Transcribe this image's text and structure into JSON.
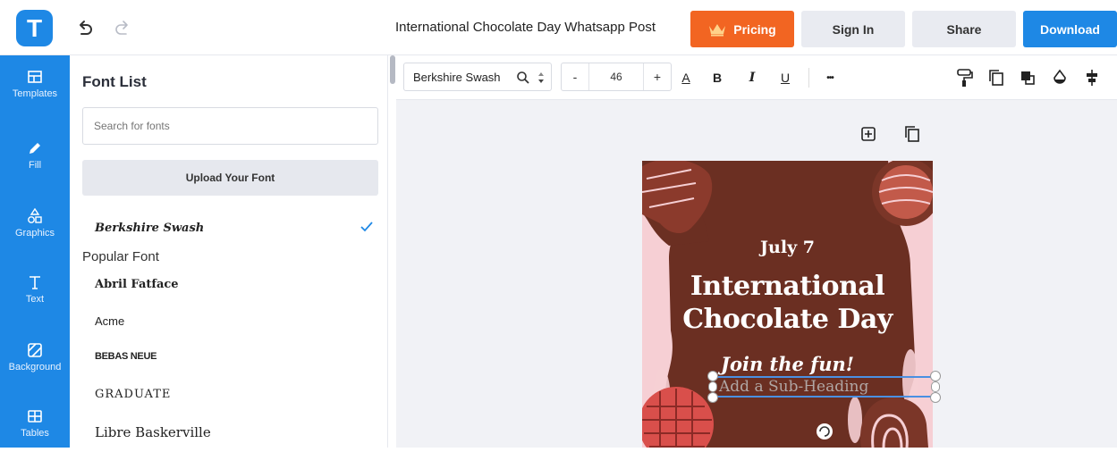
{
  "app": {
    "logo_letter": "T",
    "doc_title": "International Chocolate Day Whatsapp Post",
    "brand_color": "#1e88e5",
    "pricing_color": "#f26522"
  },
  "header": {
    "pricing_label": "Pricing",
    "signin_label": "Sign In",
    "share_label": "Share",
    "download_label": "Download"
  },
  "sidebar": {
    "items": [
      {
        "label": "Templates",
        "icon": "templates-icon"
      },
      {
        "label": "Fill",
        "icon": "pencil-icon"
      },
      {
        "label": "Graphics",
        "icon": "shapes-icon"
      },
      {
        "label": "Text",
        "icon": "text-icon"
      },
      {
        "label": "Background",
        "icon": "background-icon"
      },
      {
        "label": "Tables",
        "icon": "table-icon"
      }
    ]
  },
  "font_panel": {
    "title": "Font List",
    "search_placeholder": "Search for fonts",
    "upload_label": "Upload Your Font",
    "selected_font": "Berkshire Swash",
    "popular_heading": "Popular Font",
    "fonts": [
      "Abril Fatface",
      "Acme",
      "BEBAS NEUE",
      "GRADUATE",
      "Libre Baskerville"
    ]
  },
  "toolbar": {
    "font_name": "Berkshire Swash",
    "minus": "-",
    "font_size": "46",
    "plus": "+",
    "color_letter": "A",
    "bold": "B",
    "italic": "I",
    "underline": "U",
    "more": "•••"
  },
  "poster": {
    "date": "July 7",
    "title_line1": "International",
    "title_line2": "Chocolate Day",
    "tagline": "Join the fun!",
    "subheading": "Add a Sub-Heading",
    "colors": {
      "pink": "#f6cfd4",
      "chocolate": "#6b2f22",
      "red": "#d94f4b"
    }
  }
}
